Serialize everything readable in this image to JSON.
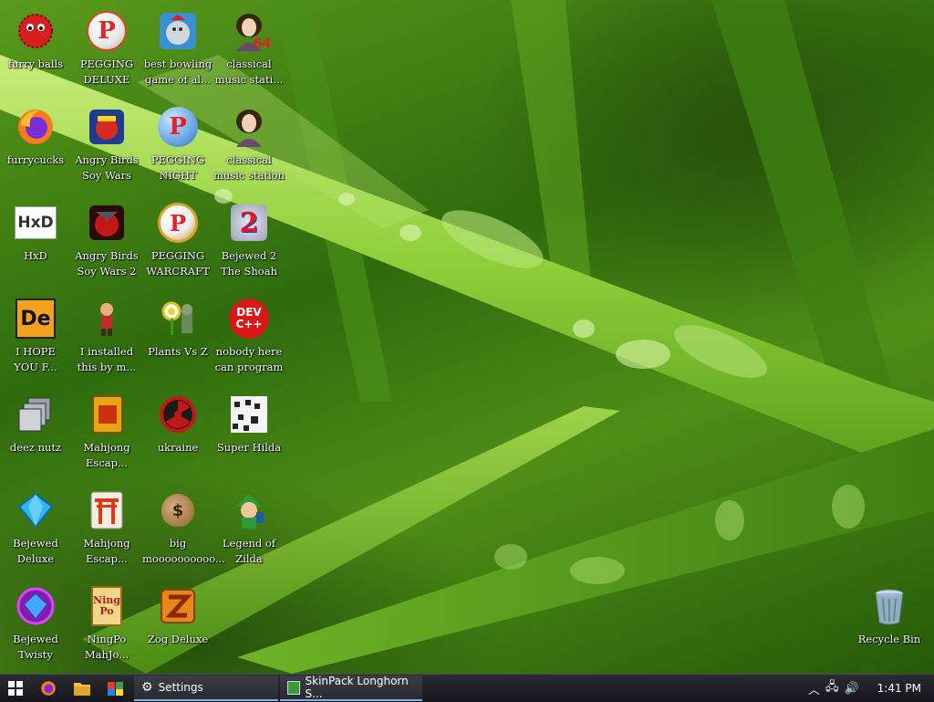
{
  "desktop_icons": [
    {
      "label": "furry balls",
      "icon": "red-furball-icon"
    },
    {
      "label": "furrycucks",
      "icon": "firefox-icon"
    },
    {
      "label": "HxD",
      "icon": "hxd-icon"
    },
    {
      "label": "I HOPE\nYOU F...",
      "icon": "de-app-icon"
    },
    {
      "label": "deez nutz",
      "icon": "stacked-windows-icon"
    },
    {
      "label": "Bejewed\nDeluxe",
      "icon": "blue-gem-icon"
    },
    {
      "label": "Bejewed\nTwisty",
      "icon": "twisty-gem-icon"
    },
    {
      "label": "PEGGING\nDELUXE",
      "icon": "peggle-icon"
    },
    {
      "label": "Angry Birds\nSoy Wars",
      "icon": "angry-birds-star-wars-icon"
    },
    {
      "label": "Angry Birds\nSoy Wars 2",
      "icon": "angry-birds-star-wars-2-icon"
    },
    {
      "label": "I installed\nthis by m...",
      "icon": "character-icon"
    },
    {
      "label": "Mahjong\nEscap...",
      "icon": "mahjong-tile-icon"
    },
    {
      "label": "Mahjong\nEscap...",
      "icon": "torii-gate-icon"
    },
    {
      "label": "NingPo\nMahJo...",
      "icon": "ningpo-tile-icon"
    },
    {
      "label": "best bowling\ngame of al...",
      "icon": "bowling-icon"
    },
    {
      "label": "PEGGING\nNIGHT",
      "icon": "peggle-night-icon"
    },
    {
      "label": "PEGGING\nWARCRAFT",
      "icon": "peggle-warcraft-icon"
    },
    {
      "label": "Plants Vs Z",
      "icon": "plants-vs-zombies-icon"
    },
    {
      "label": "ukraine",
      "icon": "radiation-icon"
    },
    {
      "label": "big\nmoooooooooo...",
      "icon": "money-bag-icon"
    },
    {
      "label": "Zog Deluxe",
      "icon": "zog-icon"
    },
    {
      "label": "classical\nmusic stati...",
      "icon": "portrait-64-icon"
    },
    {
      "label": "classical\nmusic station",
      "icon": "portrait-icon"
    },
    {
      "label": "Bejewed 2\nThe Shoah",
      "icon": "bejeweled-2-icon"
    },
    {
      "label": "nobody here\ncan program",
      "icon": "dev-cpp-icon"
    },
    {
      "label": "Super Hilda",
      "icon": "pixel-art-icon"
    },
    {
      "label": "Legend of\nZilda",
      "icon": "zelda-link-icon"
    },
    {
      "label": "Recycle Bin",
      "icon": "recycle-bin-icon"
    }
  ],
  "glyph_text": {
    "hxd": "HxD",
    "de": "De",
    "p": "P",
    "num64": "64",
    "two": "2",
    "dev": "DEV",
    "cpp": "C++",
    "ningpo": "Ning\nPo",
    "dollar": "$"
  },
  "taskbar": {
    "tasks": [
      {
        "label": "Settings",
        "icon": "gear-icon"
      },
      {
        "label": "SkinPack Longhorn S...",
        "icon": "skinpack-icon"
      }
    ],
    "clock": "1:41 PM"
  },
  "colors": {
    "accent": "#7fb0e8",
    "taskbar": "#1c1c22"
  }
}
